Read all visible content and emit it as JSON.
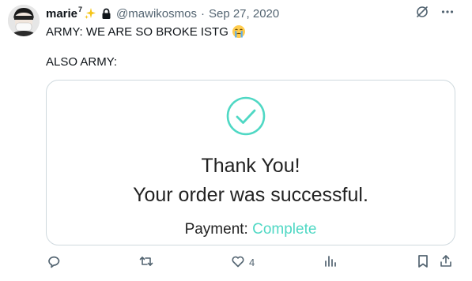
{
  "author": {
    "display_name": "marie",
    "superscript": "7",
    "handle": "@mawikosmos",
    "separator": "·",
    "date": "Sep 27, 2020"
  },
  "tweet": {
    "line1": "ARMY: WE ARE SO BROKE ISTG",
    "line2": "ALSO ARMY:"
  },
  "card": {
    "thank_you": "Thank You!",
    "message": "Your order was successful.",
    "payment_label": "Payment:",
    "payment_status": "Complete"
  },
  "actions": {
    "like_count": "4"
  },
  "colors": {
    "accent_teal": "#4fd8c4",
    "muted": "#536471",
    "text": "#0f1419",
    "border": "#cfd9de"
  },
  "icons": [
    "avatar",
    "sparkle-icon",
    "lock-icon",
    "grok-icon",
    "more-icon",
    "crying-emoji-icon",
    "check-circle-icon",
    "reply-icon",
    "retweet-icon",
    "like-icon",
    "views-icon",
    "bookmark-icon",
    "share-icon"
  ]
}
